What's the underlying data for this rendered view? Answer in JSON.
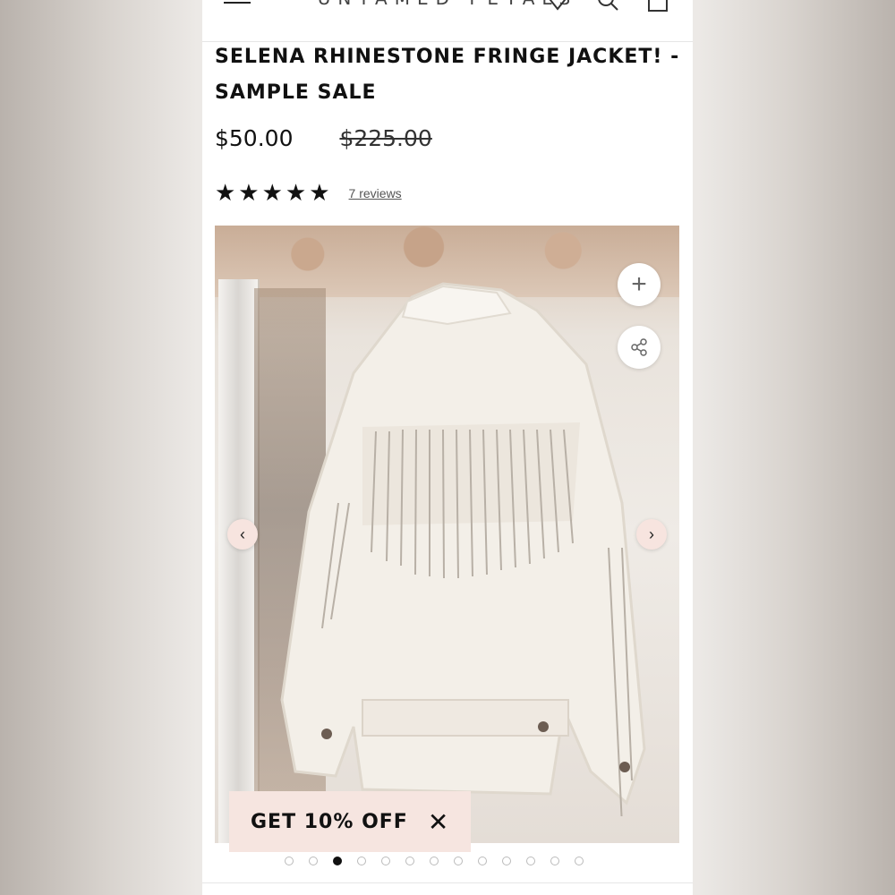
{
  "header": {
    "brand": "UNTAMED PETALS",
    "icons": [
      "menu-icon",
      "heart-icon",
      "search-icon",
      "bag-icon"
    ]
  },
  "product": {
    "title": "SELENA RHINESTONE FRINGE JACKET! - SAMPLE SALE",
    "price": "$50.00",
    "compare_price": "$225.00",
    "rating": 5,
    "stars": "★★★★★",
    "reviews_label": "7 reviews"
  },
  "gallery": {
    "image_description": "white denim jacket with rhinestone fringe",
    "zoom_symbol": "+",
    "prev_symbol": "‹",
    "next_symbol": "›",
    "dot_count": 13,
    "active_dot": 2
  },
  "promo": {
    "label": "GET 10% OFF",
    "close_symbol": "✕"
  },
  "colors": {
    "accent_pink": "#f6e5e0",
    "text": "#111111"
  }
}
